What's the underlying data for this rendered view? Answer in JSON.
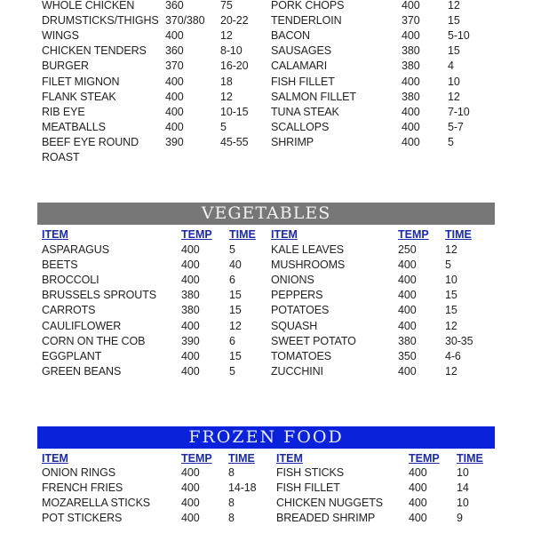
{
  "meat": {
    "rows": [
      [
        "WHOLE CHICKEN",
        "360",
        "75",
        "PORK CHOPS",
        "400",
        "12"
      ],
      [
        "DRUMSTICKS/THIGHS",
        "370/380",
        "20-22",
        "TENDERLOIN",
        "370",
        "15"
      ],
      [
        "WINGS",
        "400",
        "12",
        "BACON",
        "400",
        "5-10"
      ],
      [
        "CHICKEN TENDERS",
        "360",
        "8-10",
        "SAUSAGES",
        "380",
        "15"
      ],
      [
        "BURGER",
        "370",
        "16-20",
        "CALAMARI",
        "380",
        "4"
      ],
      [
        "FILET MIGNON",
        "400",
        "18",
        "FISH FILLET",
        "400",
        "10"
      ],
      [
        "FLANK STEAK",
        "400",
        "12",
        "SALMON FILLET",
        "380",
        "12"
      ],
      [
        "RIB EYE",
        "400",
        "10-15",
        "TUNA STEAK",
        "400",
        "7-10"
      ],
      [
        "MEATBALLS",
        "400",
        "5",
        "SCALLOPS",
        "400",
        "5-7"
      ],
      [
        "BEEF EYE ROUND",
        "390",
        "45-55",
        "SHRIMP",
        "400",
        "5"
      ],
      [
        "ROAST",
        "",
        "",
        "",
        "",
        ""
      ]
    ]
  },
  "vegetables": {
    "title": "VEGETABLES",
    "banner_color": "#777777",
    "headers": [
      "ITEM",
      "TEMP",
      "TIME",
      "ITEM",
      "TEMP",
      "TIME"
    ],
    "rows": [
      [
        "ASPARAGUS",
        "400",
        "5",
        "KALE LEAVES",
        "250",
        "12"
      ],
      [
        "BEETS",
        "400",
        "40",
        "MUSHROOMS",
        "400",
        "5"
      ],
      [
        "BROCCOLI",
        "400",
        "6",
        "ONIONS",
        "400",
        "10"
      ],
      [
        "BRUSSELS SPROUTS",
        "380",
        "15",
        "PEPPERS",
        "400",
        "15"
      ],
      [
        "CARROTS",
        "380",
        "15",
        "POTATOES",
        "400",
        "15"
      ],
      [
        "CAULIFLOWER",
        "400",
        "12",
        "SQUASH",
        "400",
        "12"
      ],
      [
        "CORN ON THE COB",
        "390",
        "6",
        "SWEET POTATO",
        "380",
        "30-35"
      ],
      [
        "EGGPLANT",
        "400",
        "15",
        "TOMATOES",
        "350",
        "4-6"
      ],
      [
        "GREEN BEANS",
        "400",
        "5",
        "ZUCCHINI",
        "400",
        "12"
      ]
    ]
  },
  "frozen": {
    "title": "FROZEN FOOD",
    "banner_color": "#0a22dc",
    "headers": [
      "ITEM",
      "TEMP",
      "TIME",
      "ITEM",
      "TEMP",
      "TIME"
    ],
    "rows": [
      [
        "ONION RINGS",
        "400",
        "8",
        "FISH STICKS",
        "400",
        "10"
      ],
      [
        "FRENCH FRIES",
        "400",
        "14-18",
        "FISH FILLET",
        "400",
        "14"
      ],
      [
        "MOZARELLA STICKS",
        "400",
        "8",
        "CHICKEN NUGGETS",
        "400",
        "10"
      ],
      [
        "POT STICKERS",
        "400",
        "8",
        "BREADED SHRIMP",
        "400",
        "9"
      ]
    ]
  }
}
